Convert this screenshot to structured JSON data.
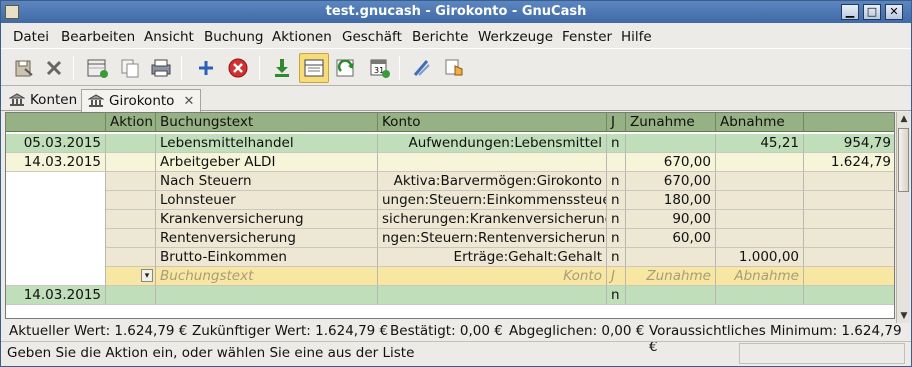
{
  "window": {
    "title": "test.gnucash - Girokonto - GnuCash",
    "minimize_glyph": "▁",
    "maximize_glyph": "□",
    "close_glyph": "✕"
  },
  "menu": [
    {
      "label": "Datei"
    },
    {
      "label": "Bearbeiten"
    },
    {
      "label": "Ansicht"
    },
    {
      "label": "Buchung"
    },
    {
      "label": "Aktionen"
    },
    {
      "label": "Geschäft"
    },
    {
      "label": "Berichte"
    },
    {
      "label": "Werkzeuge"
    },
    {
      "label": "Fenster"
    },
    {
      "label": "Hilfe"
    }
  ],
  "toolbar_icons": [
    "save-icon",
    "close-icon",
    "new-account-icon",
    "duplicate-icon",
    "print-icon",
    "add-icon",
    "delete-icon",
    "enter-icon",
    "split-view-icon",
    "blank-transaction-icon",
    "schedule-icon",
    "transfer-icon",
    "jump-icon"
  ],
  "tabs": [
    {
      "label": "Konten"
    },
    {
      "label": "Girokonto",
      "close": "✕"
    }
  ],
  "register": {
    "headers": {
      "date": "",
      "action": "Aktion",
      "description": "Buchungstext",
      "account": "Konto",
      "reconcile": "J",
      "increase": "Zunahme",
      "decrease": "Abnahme",
      "balance": ""
    },
    "transactions": [
      {
        "date": "05.03.2015",
        "action": "",
        "description": "Lebensmittelhandel",
        "account": "Aufwendungen:Lebensmittel",
        "reconcile": "n",
        "increase": "",
        "decrease": "45,21",
        "balance": "954,79"
      },
      {
        "date": "14.03.2015",
        "action": "",
        "description": "Arbeitgeber ALDI",
        "account": "",
        "reconcile": "",
        "increase": "670,00",
        "decrease": "",
        "balance": "1.624,79"
      }
    ],
    "splits": [
      {
        "action": "",
        "memo": "Nach Steuern",
        "account": "Aktiva:Barvermögen:Girokonto",
        "reconcile": "n",
        "increase": "670,00",
        "decrease": ""
      },
      {
        "action": "",
        "memo": "Lohnsteuer",
        "account": "ungen:Steuern:Einkommenssteuer",
        "reconcile": "n",
        "increase": "180,00",
        "decrease": ""
      },
      {
        "action": "",
        "memo": "Krankenversicherung",
        "account": "sicherungen:Krankenversicherung",
        "reconcile": "n",
        "increase": "90,00",
        "decrease": ""
      },
      {
        "action": "",
        "memo": "Rentenversicherung",
        "account": "ngen:Steuern:Rentenversicherung",
        "reconcile": "n",
        "increase": "60,00",
        "decrease": ""
      },
      {
        "action": "",
        "memo": "Brutto-Einkommen",
        "account": "Erträge:Gehalt:Gehalt",
        "reconcile": "n",
        "increase": "",
        "decrease": "1.000,00"
      }
    ],
    "entry_row": {
      "action_dropdown_glyph": "▾",
      "memo_placeholder": "Buchungstext",
      "account_placeholder": "Konto",
      "reconcile_placeholder": "J",
      "increase_placeholder": "Zunahme",
      "decrease_placeholder": "Abnahme"
    },
    "blank_transaction": {
      "date": "14.03.2015",
      "reconcile": "n"
    }
  },
  "summary": {
    "current": "Aktueller Wert: 1.624,79 €",
    "future": "Zukünftiger Wert: 1.624,79 €",
    "confirmed": "Bestätigt: 0,00 €",
    "reconciled": "Abgeglichen: 0,00 €",
    "minimum": "Voraussichtliches Minimum: 1.624,79 €"
  },
  "statusbar": {
    "message": "Geben Sie die Aktion ein, oder wählen Sie eine aus der Liste"
  }
}
